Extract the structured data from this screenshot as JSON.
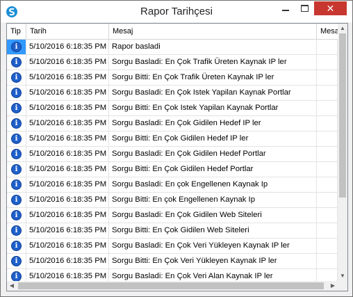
{
  "window": {
    "title": "Rapor Tarihçesi",
    "close_glyph": "✕"
  },
  "columns": {
    "tip": "Tip",
    "tarih": "Tarih",
    "mesaj": "Mesaj",
    "mesaj2": "Mesaj"
  },
  "rows": [
    {
      "tip": "info-icon",
      "tarih": "5/10/2016 6:18:35 PM",
      "mesaj": "Rapor basladi"
    },
    {
      "tip": "info-icon",
      "tarih": "5/10/2016 6:18:35 PM",
      "mesaj": "Sorgu Basladi: En Çok Trafik Üreten Kaynak IP ler"
    },
    {
      "tip": "info-icon",
      "tarih": "5/10/2016 6:18:35 PM",
      "mesaj": "Sorgu Bitti: En Çok Trafik Üreten Kaynak IP ler"
    },
    {
      "tip": "info-icon",
      "tarih": "5/10/2016 6:18:35 PM",
      "mesaj": "Sorgu Basladi: En Çok Istek Yapilan Kaynak Portlar"
    },
    {
      "tip": "info-icon",
      "tarih": "5/10/2016 6:18:35 PM",
      "mesaj": "Sorgu Bitti: En Çok Istek Yapilan Kaynak Portlar"
    },
    {
      "tip": "info-icon",
      "tarih": "5/10/2016 6:18:35 PM",
      "mesaj": "Sorgu Basladi: En Çok Gidilen Hedef IP ler"
    },
    {
      "tip": "info-icon",
      "tarih": "5/10/2016 6:18:35 PM",
      "mesaj": "Sorgu Bitti: En Çok Gidilen Hedef IP ler"
    },
    {
      "tip": "info-icon",
      "tarih": "5/10/2016 6:18:35 PM",
      "mesaj": "Sorgu Basladi: En Çok Gidilen Hedef Portlar"
    },
    {
      "tip": "info-icon",
      "tarih": "5/10/2016 6:18:35 PM",
      "mesaj": "Sorgu Bitti: En Çok Gidilen Hedef Portlar"
    },
    {
      "tip": "info-icon",
      "tarih": "5/10/2016 6:18:35 PM",
      "mesaj": "Sorgu Basladi: En çok Engellenen Kaynak Ip"
    },
    {
      "tip": "info-icon",
      "tarih": "5/10/2016 6:18:35 PM",
      "mesaj": "Sorgu Bitti: En çok Engellenen Kaynak Ip"
    },
    {
      "tip": "info-icon",
      "tarih": "5/10/2016 6:18:35 PM",
      "mesaj": "Sorgu Basladi: En Çok Gidilen Web Siteleri"
    },
    {
      "tip": "info-icon",
      "tarih": "5/10/2016 6:18:35 PM",
      "mesaj": "Sorgu Bitti: En Çok Gidilen Web Siteleri"
    },
    {
      "tip": "info-icon",
      "tarih": "5/10/2016 6:18:35 PM",
      "mesaj": "Sorgu Basladi: En Çok Veri Yükleyen Kaynak IP ler"
    },
    {
      "tip": "info-icon",
      "tarih": "5/10/2016 6:18:35 PM",
      "mesaj": "Sorgu Bitti: En Çok Veri Yükleyen Kaynak IP ler"
    },
    {
      "tip": "info-icon",
      "tarih": "5/10/2016 6:18:35 PM",
      "mesaj": "Sorgu Basladi: En Çok Veri Alan Kaynak IP ler"
    }
  ],
  "info_glyph": "i",
  "colors": {
    "selection": "#3399ff",
    "close_button": "#c7372f",
    "info_icon": "#1f5fc9"
  },
  "icons": {
    "app": "app-s-icon",
    "scroll_up": "▲",
    "scroll_down": "▼",
    "scroll_left": "◀",
    "scroll_right": "▶"
  }
}
